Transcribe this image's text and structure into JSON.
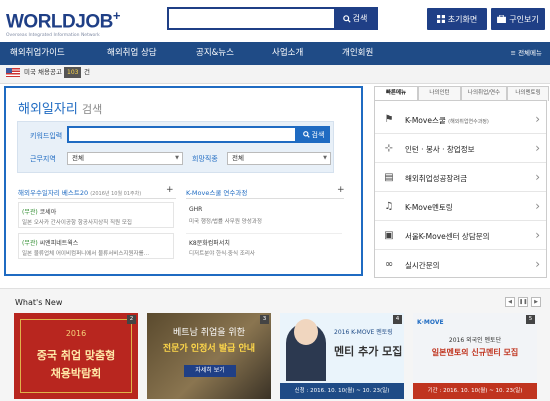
{
  "header": {
    "logo_main": "WORLDJOB",
    "logo_plus": "+",
    "logo_sub": "Overseas Integrated Information Network",
    "search_button": "검색",
    "home_button": "초기화면",
    "jobseek_button": "구인보기"
  },
  "gnb": {
    "items": [
      "해외취업가이드",
      "해외취업 상담",
      "공지&뉴스",
      "사업소개",
      "개인회원"
    ],
    "all_menu": "전체메뉴"
  },
  "subbar": {
    "us_jobs": "미국 채용공고",
    "count": "103",
    "unit": "건"
  },
  "search_panel": {
    "title": "해외일자리",
    "title_suffix": "검색",
    "keyword_label": "키워드입력",
    "keyword_button": "검색",
    "region_label": "근무지역",
    "region_value": "전체",
    "job_label": "희망직종",
    "job_value": "전체"
  },
  "best20": {
    "title": "해외우수일자리 베스트20",
    "period": "(2016년 10월 01주차)",
    "items": [
      {
        "tag": "(무관)",
        "company": "코세아",
        "desc": "일본 오사카 간사이공항 항공사지상직 직원 모집"
      },
      {
        "tag": "(무관)",
        "company": "씨엔피네트웍스",
        "desc": "일본 물류업체 어이비컴퍼니에서 물류서비스지원자를…"
      }
    ]
  },
  "kmove_course": {
    "title": "K-Move스쿨 연수과정",
    "items": [
      {
        "company": "GHR",
        "desc": "미국 행정/법률 사무원 양성과정"
      },
      {
        "company": "K8문화컴퍼서치",
        "desc": "디저트분야 한식·중식 조리사"
      }
    ]
  },
  "quick": {
    "tabs": [
      "빠른메뉴",
      "나의인턴",
      "나의취업/연수",
      "나의멘토링"
    ],
    "items": [
      {
        "label": "K-Move스쿨",
        "sub": "(해외취업연수과정)",
        "icon": "megaphone-icon"
      },
      {
        "label": "인턴 · 봉사 · 창업정보",
        "sub": "",
        "icon": "network-icon"
      },
      {
        "label": "해외취업성공장려금",
        "sub": "",
        "icon": "document-icon"
      },
      {
        "label": "K-Move멘토링",
        "sub": "",
        "icon": "bell-icon"
      },
      {
        "label": "서울K-Move센터 상담문의",
        "sub": "",
        "icon": "briefcase-icon"
      },
      {
        "label": "실시간문의",
        "sub": "",
        "icon": "glasses-icon"
      }
    ]
  },
  "whats_new": {
    "label": "What's New",
    "thumbs": [
      {
        "num": "2",
        "line1": "2016",
        "line2": "중국 취업 맞춤형",
        "line3": "채용박람회"
      },
      {
        "num": "3",
        "line1": "베트남 취업을 위한",
        "line2": "전문가 인정서 발급 안내",
        "line3": "자세히 보기"
      },
      {
        "num": "4",
        "line1": "2016 K-MOVE 멘토링",
        "line2": "멘티 추가 모집",
        "line3": "신청 : 2016. 10. 10(월) ~ 10. 23(일)"
      },
      {
        "num": "5",
        "line1": "2016 외국인 멘토단",
        "line2": "일본멘토의 신규멘티 모집",
        "line3": "기간 : 2016. 10. 10(월) ~ 10. 23(일)"
      }
    ]
  },
  "colors": {
    "navy": "#1f4b86",
    "blue": "#1f6bc2"
  }
}
